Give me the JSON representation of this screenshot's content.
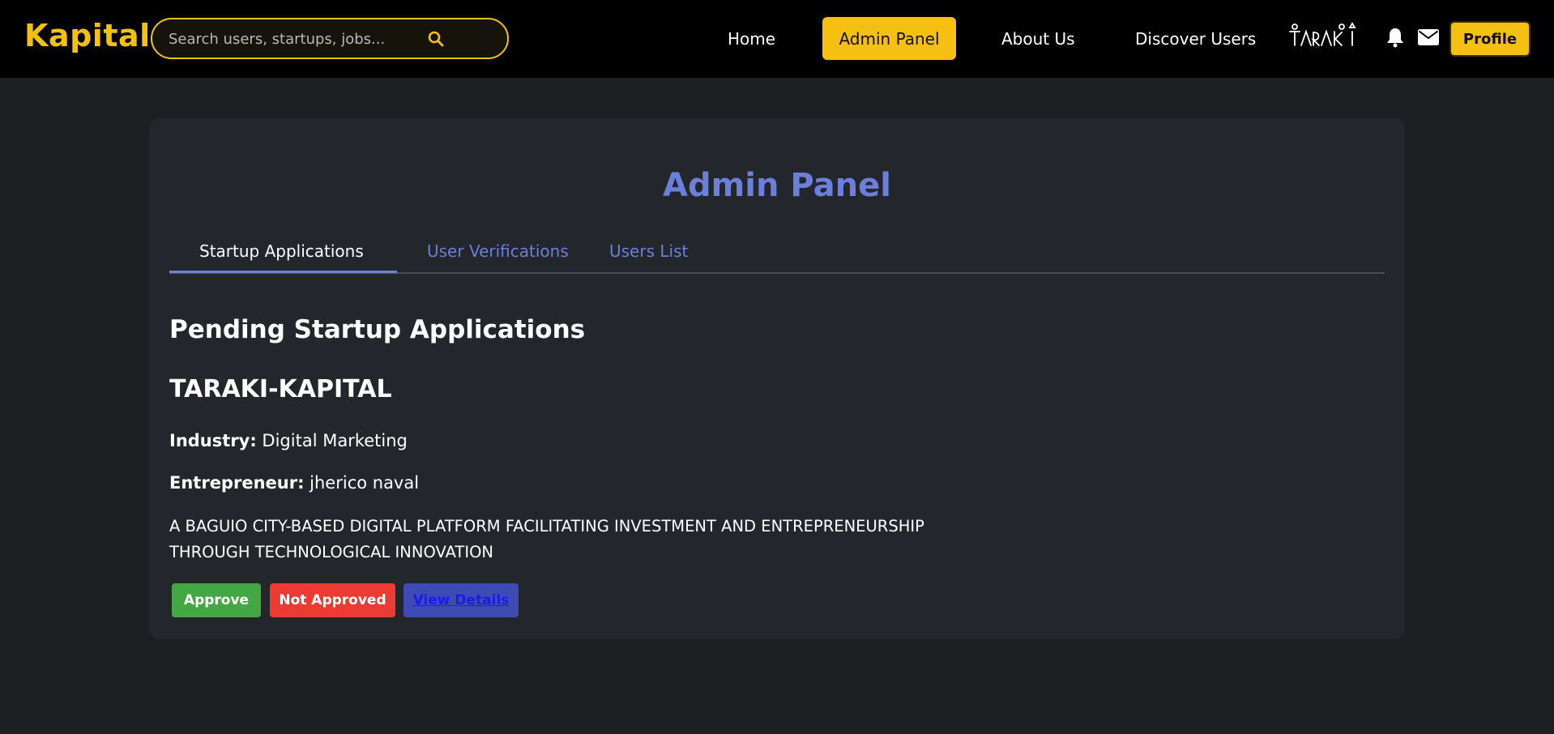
{
  "brand": {
    "name": "Kapital",
    "color": "#f5c012"
  },
  "search": {
    "placeholder": "Search users, startups, jobs...",
    "value": "",
    "icon": "search-icon"
  },
  "nav": {
    "home": "Home",
    "admin_panel": "Admin Panel",
    "about_us": "About Us",
    "discover_users": "Discover Users",
    "partner_logo": "TARAKI",
    "notifications_icon": "bell-icon",
    "messages_icon": "mail-icon",
    "profile": "Profile"
  },
  "main": {
    "title": "Admin Panel",
    "tabs": [
      {
        "label": "Startup Applications",
        "active": true
      },
      {
        "label": "User Verifications",
        "active": false
      },
      {
        "label": "Users List",
        "active": false
      }
    ],
    "section_title": "Pending Startup Applications",
    "application": {
      "name": "TARAKI-KAPITAL",
      "industry_label": "Industry:",
      "industry": "Digital Marketing",
      "entrepreneur_label": "Entrepreneur:",
      "entrepreneur": "jherico naval",
      "description": "A BAGUIO CITY-BASED DIGITAL PLATFORM FACILITATING INVESTMENT AND ENTREPRENEURSHIP THROUGH TECHNOLOGICAL INNOVATION"
    },
    "actions": {
      "approve": "Approve",
      "not_approved": "Not Approved",
      "view_details": "View Details"
    }
  },
  "colors": {
    "accent": "#f5c012",
    "title_blue": "#6b7fdb",
    "approve_green": "#43a743",
    "reject_red": "#ec3b33",
    "details_blue": "#3f4bb5"
  }
}
